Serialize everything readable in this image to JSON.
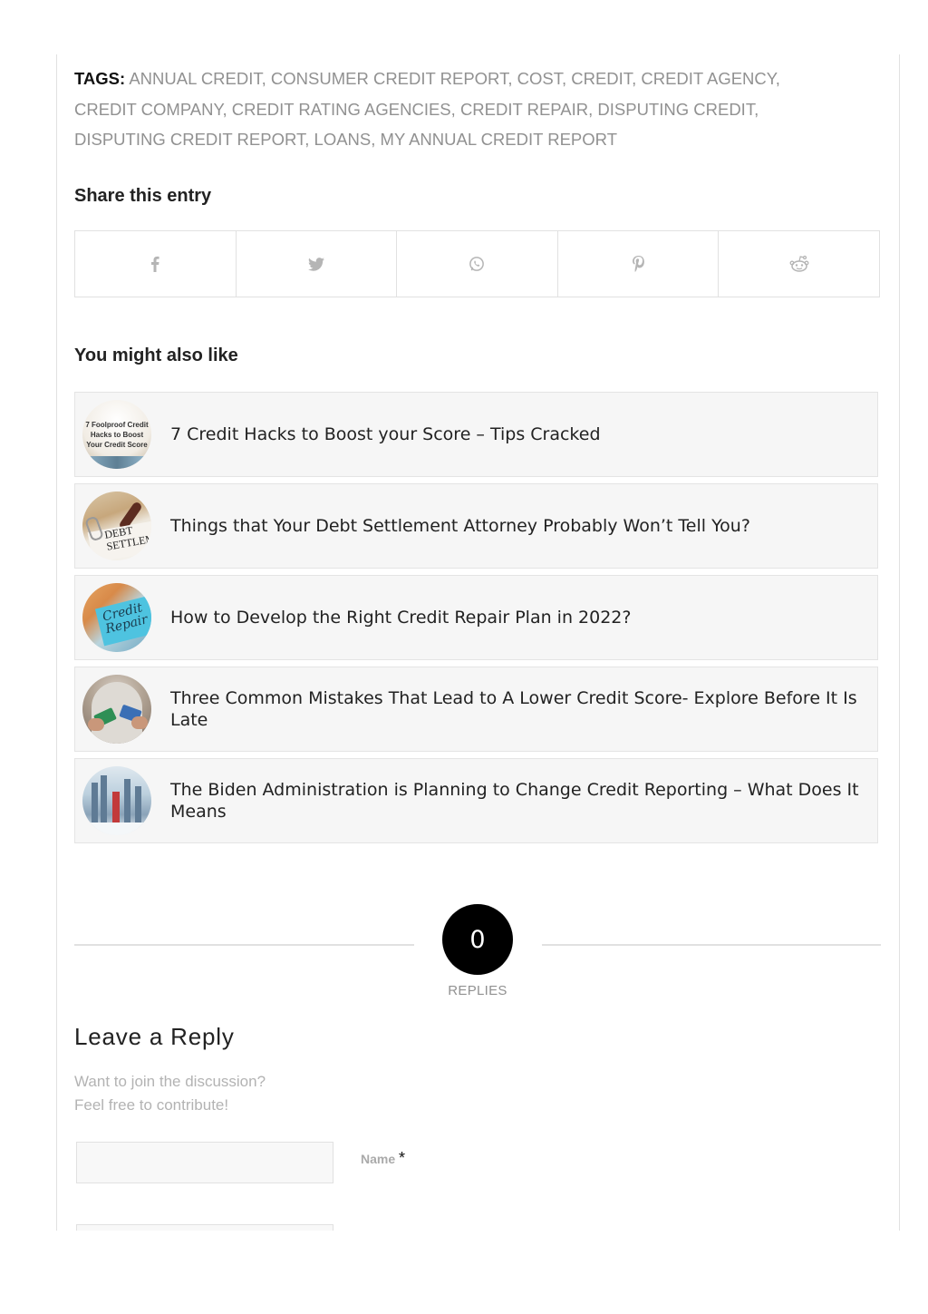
{
  "tags": {
    "label": "TAGS:",
    "items": [
      "ANNUAL CREDIT",
      "CONSUMER CREDIT REPORT",
      "COST",
      "CREDIT",
      "CREDIT AGENCY",
      "CREDIT COMPANY",
      "CREDIT RATING AGENCIES",
      "CREDIT REPAIR",
      "DISPUTING CREDIT",
      "DISPUTING CREDIT REPORT",
      "LOANS",
      "MY ANNUAL CREDIT REPORT"
    ]
  },
  "share": {
    "heading": "Share this entry",
    "buttons": [
      {
        "icon": "facebook-icon"
      },
      {
        "icon": "twitter-icon"
      },
      {
        "icon": "whatsapp-icon"
      },
      {
        "icon": "pinterest-icon"
      },
      {
        "icon": "reddit-icon"
      }
    ]
  },
  "related": {
    "heading": "You might also like",
    "items": [
      {
        "title": "7 Credit Hacks to Boost your Score – Tips Cracked",
        "thumb_text": "7 Foolproof Credit Hacks to Boost Your Credit Score"
      },
      {
        "title": "Things that Your Debt Settlement Attorney Probably Won’t Tell You?",
        "thumb_text": "DEBT SETTLEMENT"
      },
      {
        "title": "How to Develop the Right Credit Repair Plan in 2022?",
        "thumb_text": "Credit Repair"
      },
      {
        "title": "Three Common Mistakes That Lead to A Lower Credit Score- Explore Before It Is Late"
      },
      {
        "title": "The Biden Administration is Planning to Change Credit Reporting – What Does It Means"
      }
    ]
  },
  "replies": {
    "count": "0",
    "label": "REPLIES"
  },
  "reply_form": {
    "title": "Leave a Reply",
    "subtitle_line1": "Want to join the discussion?",
    "subtitle_line2": "Feel free to contribute!",
    "name_label": "Name",
    "name_required": "*",
    "name_value": "",
    "email_value": ""
  },
  "colors": {
    "border": "#e1e1e1",
    "tag_text": "#919191",
    "card_bg": "#f6f6f6",
    "reply_circle": "#000000"
  }
}
